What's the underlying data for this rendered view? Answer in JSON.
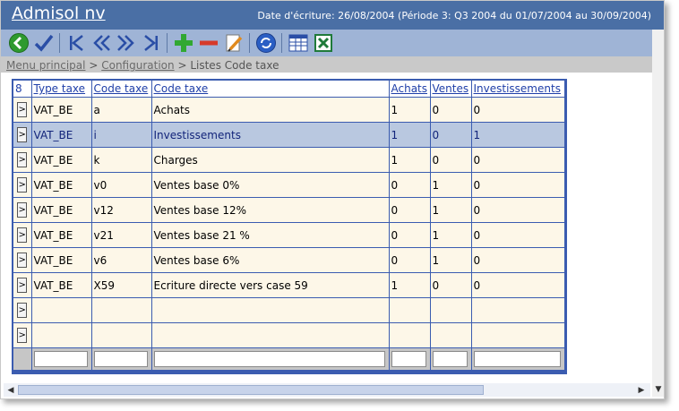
{
  "app": {
    "title": "Admisol nv",
    "period_info": "Date d'écriture: 26/08/2004 (Période 3: Q3 2004 du 01/07/2004 au 30/09/2004)"
  },
  "toolbar": {
    "icons": [
      "back-icon",
      "check-icon",
      "first-record-icon",
      "previous-record-icon",
      "next-record-icon",
      "last-record-icon",
      "add-icon",
      "delete-icon",
      "edit-icon",
      "refresh-icon",
      "table-view-icon",
      "excel-export-icon"
    ]
  },
  "breadcrumb": {
    "menu": "Menu principal",
    "sep1": ">",
    "config": "Configuration",
    "sep2": ">",
    "current": "Listes Code taxe"
  },
  "grid": {
    "count": "8",
    "headers": [
      "Type taxe",
      "Code taxe",
      "Code taxe",
      "Achats",
      "Ventes",
      "Investissements"
    ],
    "rows": [
      [
        "VAT_BE",
        "a",
        "Achats",
        "1",
        "0",
        "0"
      ],
      [
        "VAT_BE",
        "i",
        "Investissements",
        "1",
        "0",
        "1"
      ],
      [
        "VAT_BE",
        "k",
        "Charges",
        "1",
        "0",
        "0"
      ],
      [
        "VAT_BE",
        "v0",
        "Ventes base 0%",
        "0",
        "1",
        "0"
      ],
      [
        "VAT_BE",
        "v12",
        "Ventes base 12%",
        "0",
        "1",
        "0"
      ],
      [
        "VAT_BE",
        "v21",
        "Ventes base 21 %",
        "0",
        "1",
        "0"
      ],
      [
        "VAT_BE",
        "v6",
        "Ventes base 6%",
        "0",
        "1",
        "0"
      ],
      [
        "VAT_BE",
        "X59",
        "Ecriture directe vers case 59",
        "1",
        "0",
        "0"
      ]
    ],
    "row_button": ">",
    "selected_row": 1,
    "empty_rows": 2
  },
  "colors": {
    "title_bar": "#4a6fa5",
    "toolbar": "#9fb4d6",
    "grid_border": "#3b5cb0",
    "row_bg": "#fdf7e8",
    "selected_bg": "#b9c8e0"
  }
}
